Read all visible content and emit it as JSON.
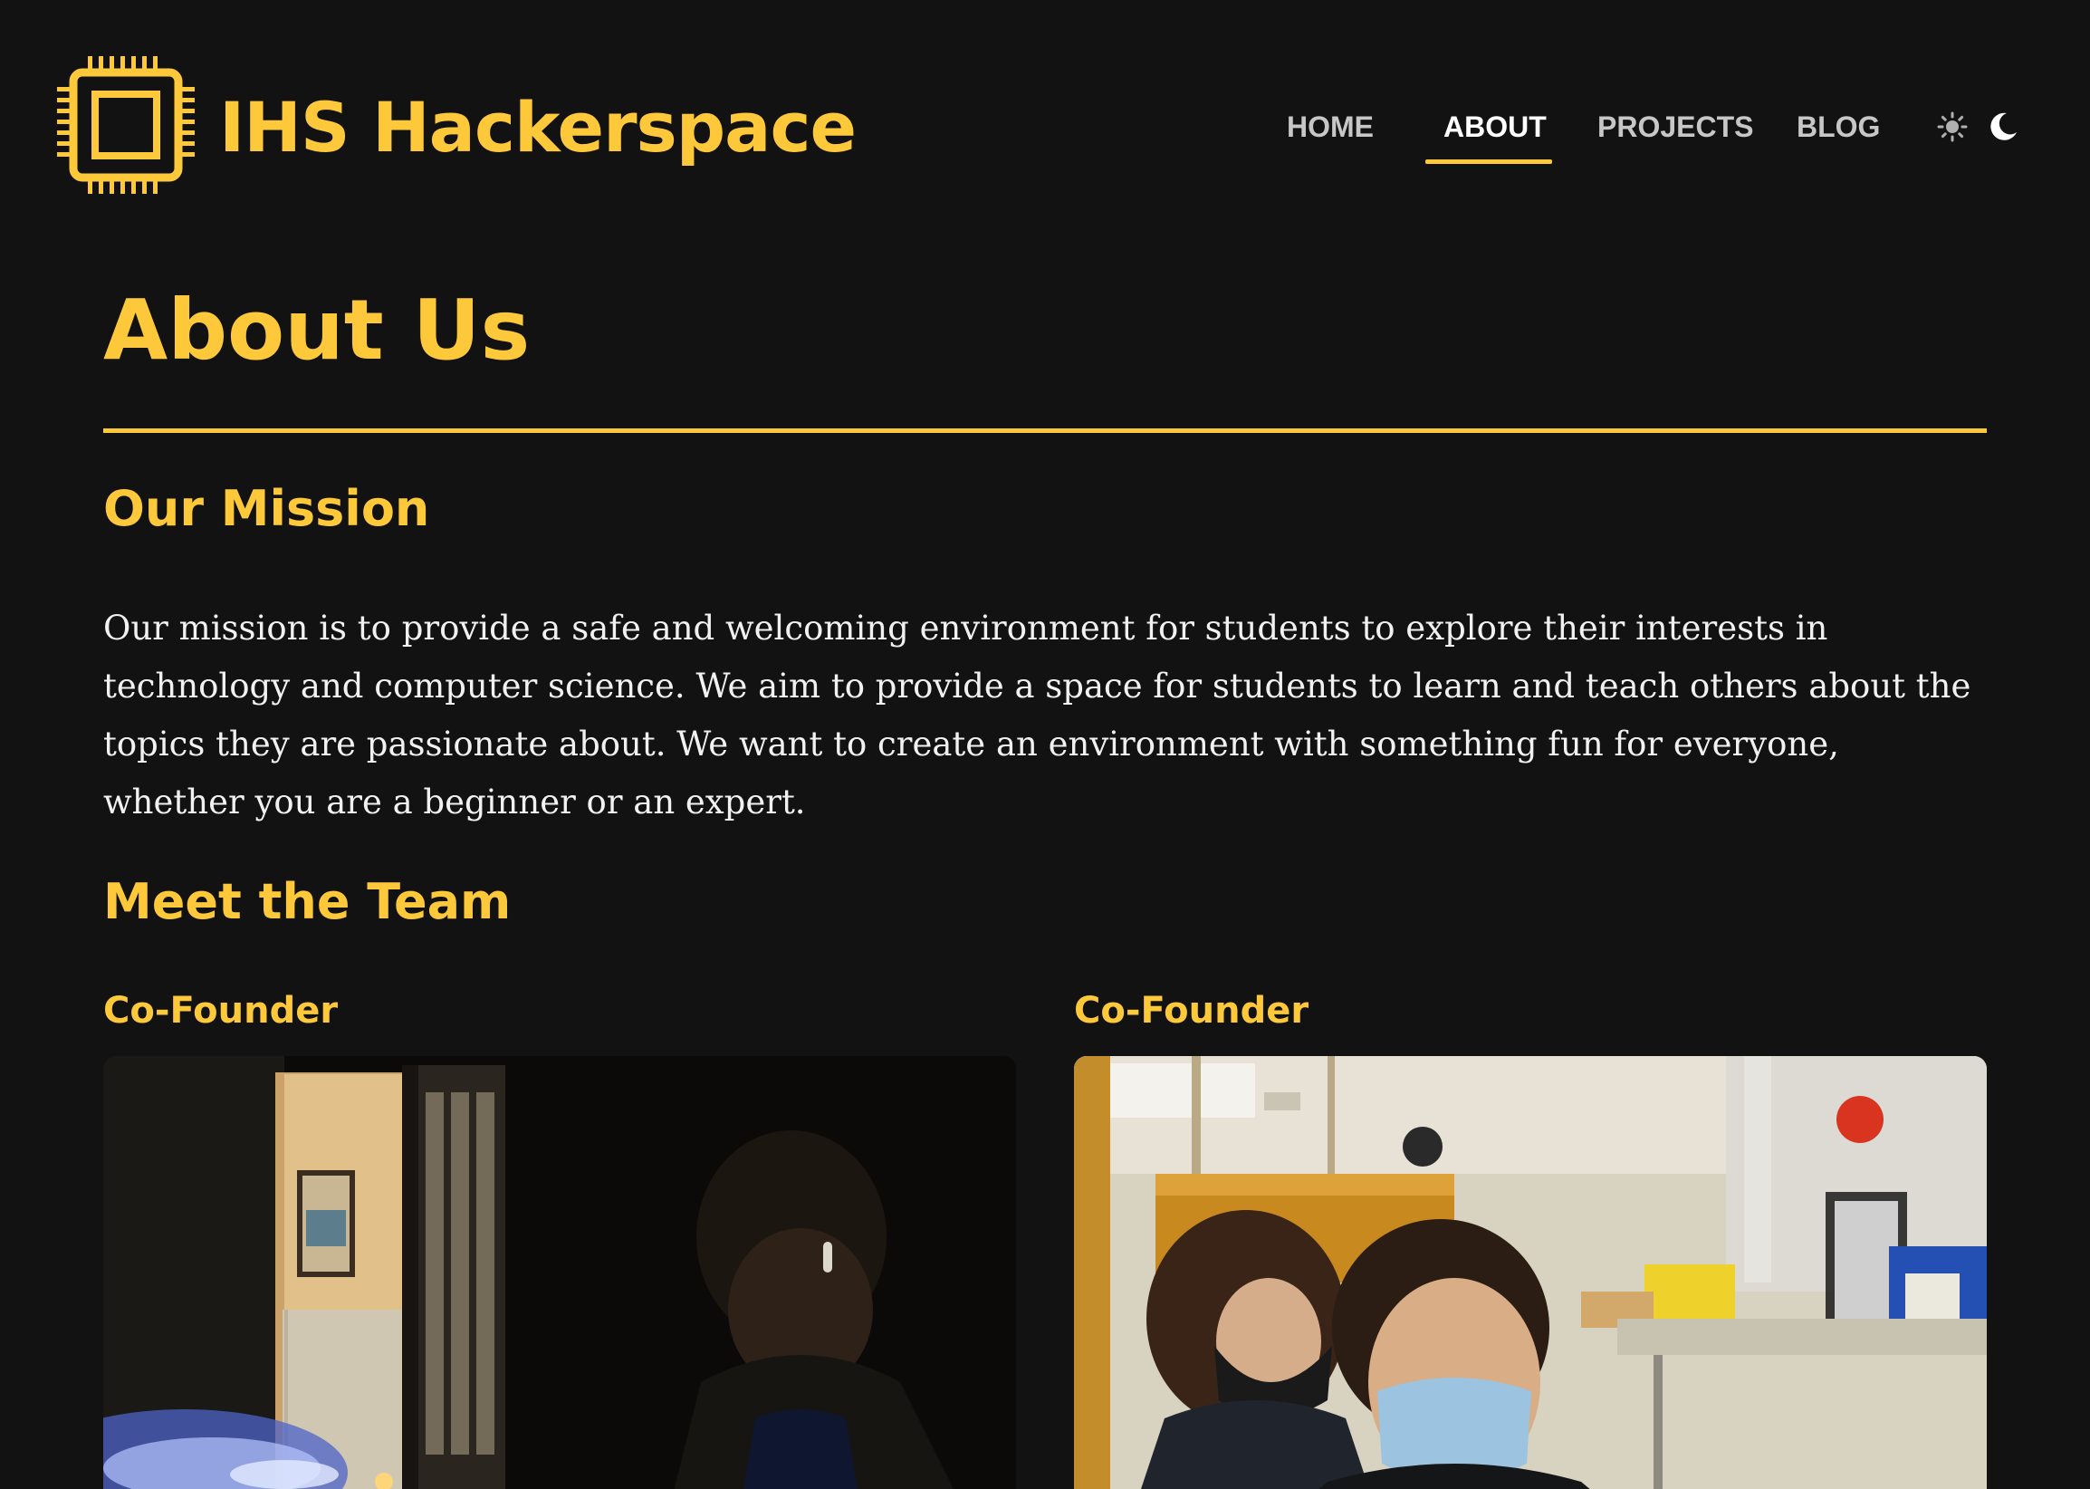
{
  "site": {
    "brand": "IHS Hackerspace",
    "accent_color": "#fdc93b",
    "background_color": "#121212",
    "logo_icon": "cpu-chip-icon"
  },
  "nav": {
    "items": [
      {
        "label": "HOME",
        "active": false
      },
      {
        "label": "ABOUT",
        "active": true
      },
      {
        "label": "PROJECTS",
        "active": false
      },
      {
        "label": "BLOG",
        "active": false
      }
    ],
    "theme_toggle": {
      "light_icon": "sun-icon",
      "dark_icon": "moon-icon",
      "selected": "dark"
    }
  },
  "page": {
    "title": "About Us",
    "sections": {
      "mission": {
        "heading": "Our Mission",
        "body": "Our mission is to provide a safe and welcoming environment for students to explore their interests in technology and computer science. We aim to provide a space for students to learn and teach others about the topics they are passionate about. We want to create an environment with something fun for everyone, whether you are a beginner or an expert."
      },
      "team": {
        "heading": "Meet the Team",
        "members": [
          {
            "role": "Co-Founder"
          },
          {
            "role": "Co-Founder"
          }
        ]
      }
    }
  }
}
